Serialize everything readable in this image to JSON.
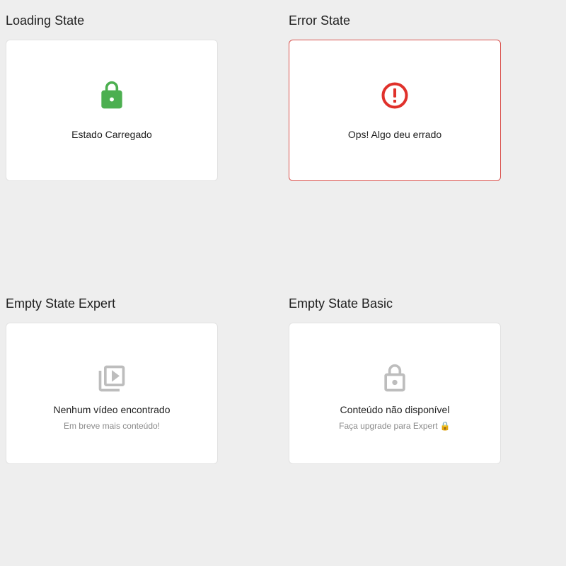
{
  "colors": {
    "background": "#eeeeee",
    "card": "#ffffff",
    "success": "#4caf50",
    "error": "#e0312b",
    "muted_icon": "#bdbdbd"
  },
  "loading": {
    "section_title": "Loading State",
    "icon": "lock-icon",
    "message": "Estado Carregado"
  },
  "error": {
    "section_title": "Error State",
    "icon": "error-circle-icon",
    "message": "Ops! Algo deu errado"
  },
  "empty_expert": {
    "section_title": "Empty State Expert",
    "icon": "video-library-icon",
    "message": "Nenhum vídeo encontrado",
    "submessage": "Em breve mais conteúdo!"
  },
  "empty_basic": {
    "section_title": "Empty State Basic",
    "icon": "lock-icon",
    "message": "Conteúdo não disponível",
    "submessage": "Faça upgrade para Expert 🔒"
  }
}
